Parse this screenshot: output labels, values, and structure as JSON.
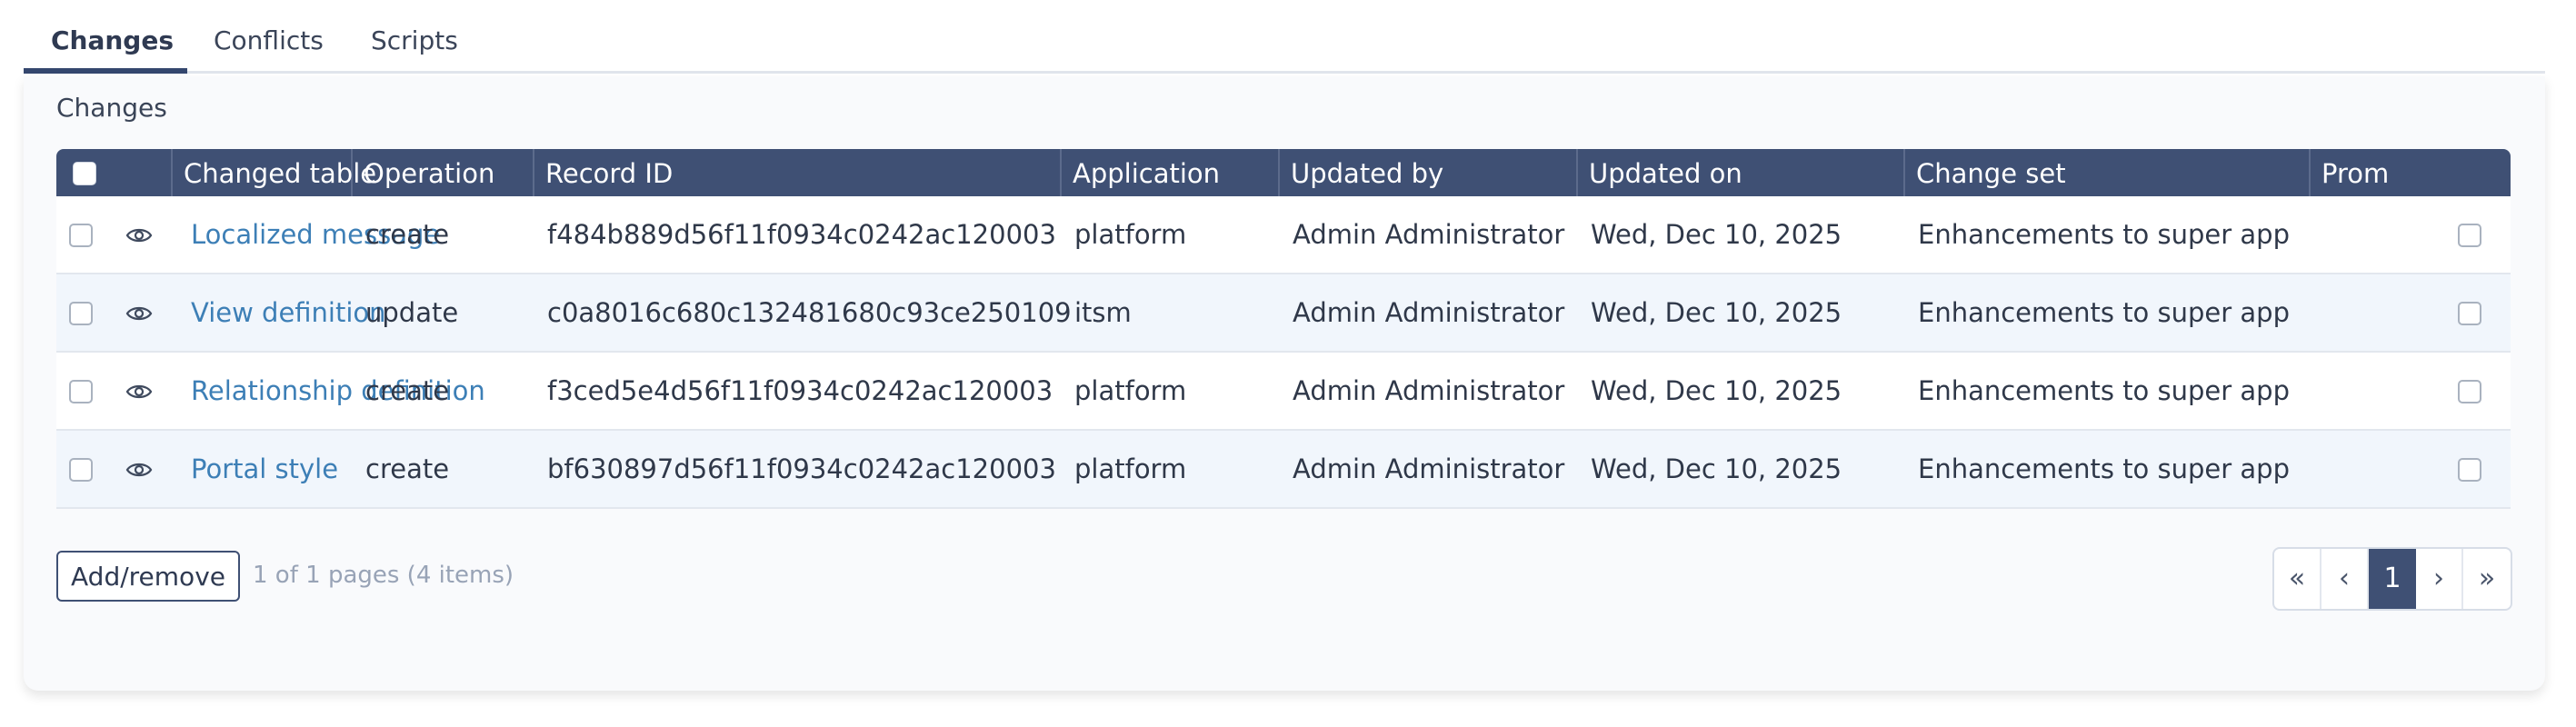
{
  "tabs": [
    {
      "label": "Changes",
      "active": true
    },
    {
      "label": "Conflicts",
      "active": false
    },
    {
      "label": "Scripts",
      "active": false
    }
  ],
  "section_title": "Changes",
  "columns": {
    "changed_table": "Changed table",
    "operation": "Operation",
    "record_id": "Record ID",
    "application": "Application",
    "updated_by": "Updated by",
    "updated_on": "Updated on",
    "change_set": "Change set",
    "promote": "Prom"
  },
  "rows": [
    {
      "changed_table": "Localized message",
      "operation": "create",
      "record_id": "f484b889d56f11f0934c0242ac120003",
      "application": "platform",
      "updated_by": "Admin Administrator",
      "updated_on": "Wed, Dec 10, 2025",
      "change_set": "Enhancements to super app"
    },
    {
      "changed_table": "View definition",
      "operation": "update",
      "record_id": "c0a8016c680c132481680c93ce250109",
      "application": "itsm",
      "updated_by": "Admin Administrator",
      "updated_on": "Wed, Dec 10, 2025",
      "change_set": "Enhancements to super app"
    },
    {
      "changed_table": "Relationship definition",
      "operation": "create",
      "record_id": "f3ced5e4d56f11f0934c0242ac120003",
      "application": "platform",
      "updated_by": "Admin Administrator",
      "updated_on": "Wed, Dec 10, 2025",
      "change_set": "Enhancements to super app"
    },
    {
      "changed_table": "Portal style",
      "operation": "create",
      "record_id": "bf630897d56f11f0934c0242ac120003",
      "application": "platform",
      "updated_by": "Admin Administrator",
      "updated_on": "Wed, Dec 10, 2025",
      "change_set": "Enhancements to super app"
    }
  ],
  "footer": {
    "add_remove_label": "Add/remove",
    "pagination_text": "1 of 1 pages (4 items)"
  },
  "pager": {
    "first": "«",
    "prev": "‹",
    "current": "1",
    "next": "›",
    "last": "»"
  },
  "icons": {
    "view": "eye-icon"
  },
  "colors": {
    "header_bg": "#3f5074",
    "link": "#3d7fb6",
    "row_alt": "#f1f6fc",
    "scroll_thumb": "#b7c2d6"
  }
}
